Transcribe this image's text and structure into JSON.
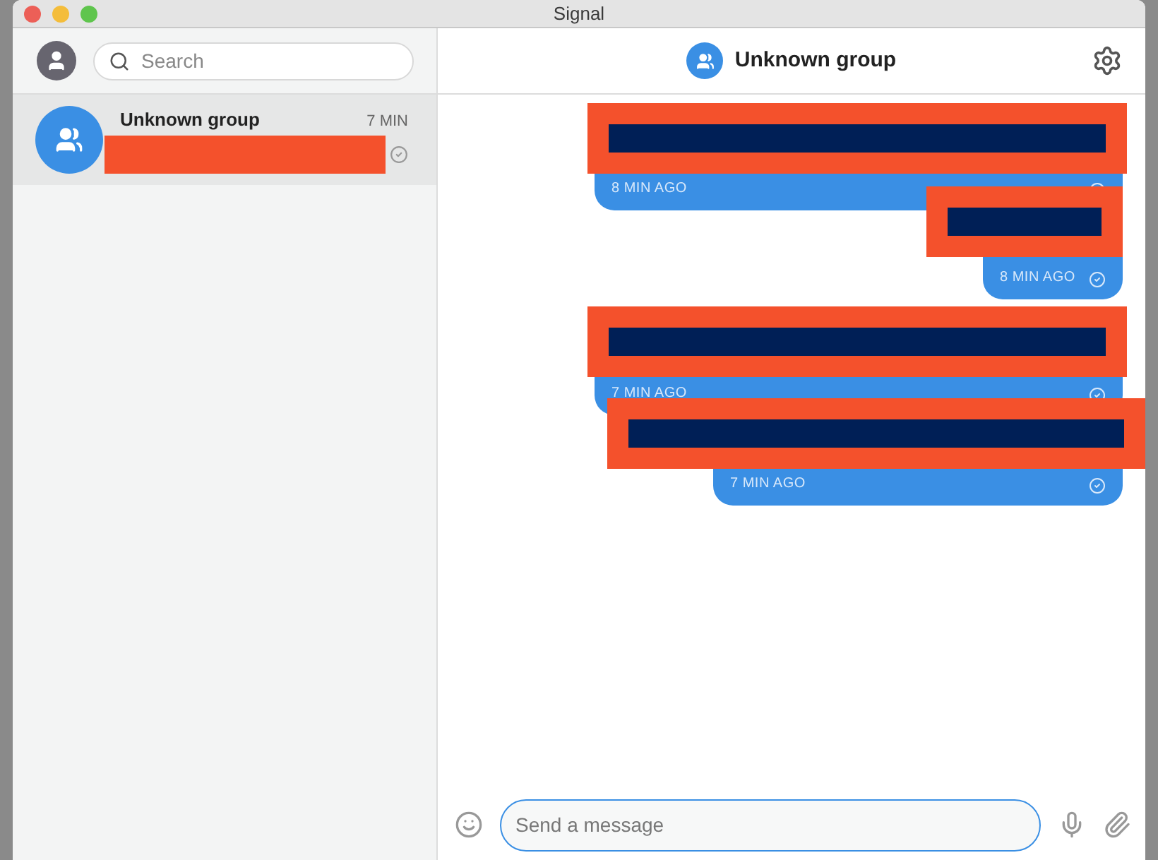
{
  "window": {
    "title": "Signal"
  },
  "search": {
    "placeholder": "Search"
  },
  "conversations": [
    {
      "name": "Unknown group",
      "time": "7 MIN",
      "selected": true,
      "preview_redacted": true,
      "delivered": true
    }
  ],
  "header": {
    "title": "Unknown group"
  },
  "messages": [
    {
      "time": "8 MIN AGO",
      "delivered": true,
      "redacted": true
    },
    {
      "time": "8 MIN AGO",
      "delivered": true,
      "redacted": true
    },
    {
      "time": "7 MIN AGO",
      "delivered": true,
      "redacted": true
    },
    {
      "time": "7 MIN AGO",
      "delivered": true,
      "redacted": true
    }
  ],
  "composer": {
    "placeholder": "Send a message"
  }
}
